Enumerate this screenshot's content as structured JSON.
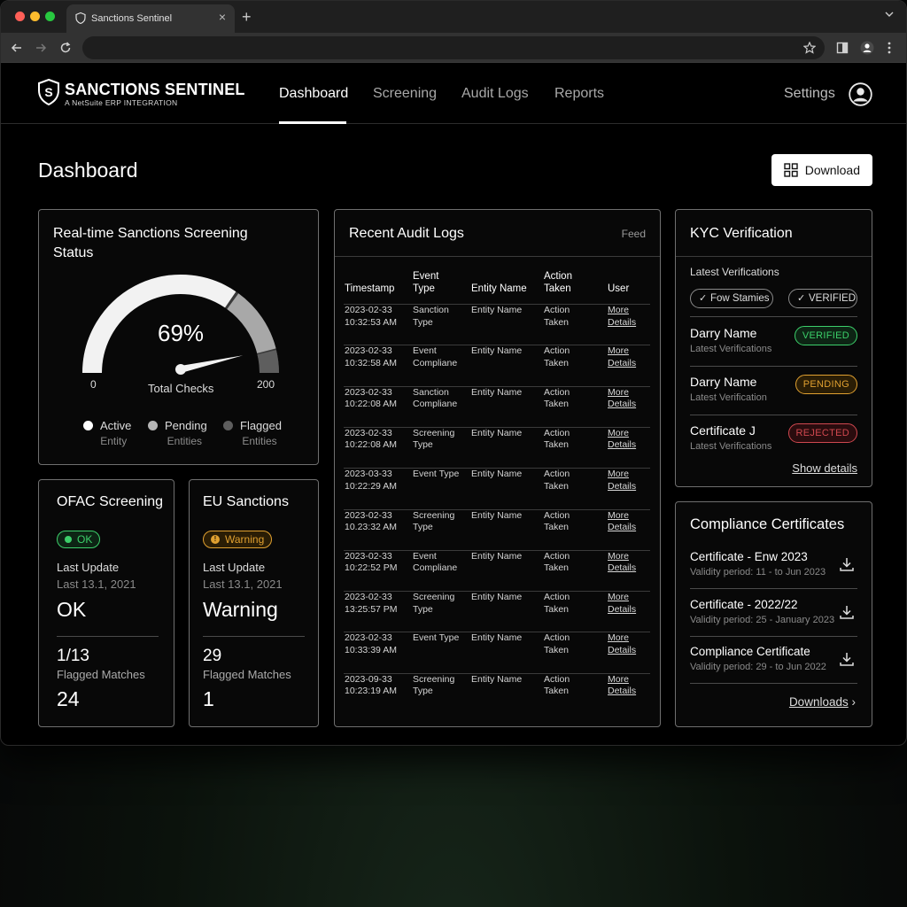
{
  "browser": {
    "tab_title": "Sanctions Sentinel",
    "tab_close": "×",
    "new_tab": "+"
  },
  "app": {
    "brand": "SANCTIONS SENTINEL",
    "brand_sub": "A NetSuite ERP INTEGRATION",
    "nav": [
      "Dashboard",
      "Screening",
      "Audit Logs",
      "Reports"
    ],
    "settings": "Settings"
  },
  "page": {
    "title": "Dashboard",
    "download_label": "Download"
  },
  "gauge_card": {
    "title": "Real-time Sanctions Screening Status",
    "percent": "69%",
    "percent_value": 69,
    "min": "0",
    "max": "200",
    "label": "Total Checks",
    "legend": [
      {
        "label": "Active",
        "sub": "Entity",
        "color": "#ffffff"
      },
      {
        "label": "Pending",
        "sub": "Entities",
        "color": "#b5b5b5"
      },
      {
        "label": "Flagged",
        "sub": "Entities",
        "color": "#5e5e5e"
      }
    ]
  },
  "ofac": {
    "title": "OFAC Screening",
    "badge": "OK",
    "last_update_label": "Last Update",
    "last_update_value": "Last 13.1, 2021",
    "status": "OK",
    "matches": "1/13",
    "matches_label": "Flagged Matches",
    "count": "24"
  },
  "eu": {
    "title": "EU Sanctions",
    "badge": "Warning",
    "last_update_label": "Last Update",
    "last_update_value": "Last 13.1, 2021",
    "status": "Warning",
    "matches": "29",
    "matches_label": "Flagged Matches",
    "count": "1"
  },
  "audit": {
    "title": "Recent Audit Logs",
    "feed": "Feed",
    "columns": [
      "Timestamp",
      "Event Type",
      "Entity Name",
      "Action Taken",
      "User"
    ],
    "rows": [
      {
        "ts": "2023-02-33 10:32:53 AM",
        "event": "Sanction Type",
        "entity": "Entity Name",
        "action": "Action Taken",
        "user": "More Details"
      },
      {
        "ts": "2023-02-33 10:32:58 AM",
        "event": "Event Compliane",
        "entity": "Entity Name",
        "action": "Action Taken",
        "user": "More Details"
      },
      {
        "ts": "2023-02-33 10:22:08 AM",
        "event": "Sanction Compliane",
        "entity": "Entity Name",
        "action": "Action Taken",
        "user": "More Details"
      },
      {
        "ts": "2023-02-33 10:22:08 AM",
        "event": "Screening Type",
        "entity": "Entity Name",
        "action": "Action Taken",
        "user": "More Details"
      },
      {
        "ts": "2023-03-33 10:22:29 AM",
        "event": "Event Type",
        "entity": "Entity Name",
        "action": "Action Taken",
        "user": "More Details"
      },
      {
        "ts": "2023-02-33 10.23:32 AM",
        "event": "Screening Type",
        "entity": "Entity Name",
        "action": "Action Taken",
        "user": "More Details"
      },
      {
        "ts": "2023-02-33 10:22:52 PM",
        "event": "Event Compliane",
        "entity": "Entity Name",
        "action": "Action Taken",
        "user": "More Details"
      },
      {
        "ts": "2023-02-33 13:25:57 PM",
        "event": "Screening Type",
        "entity": "Entity Name",
        "action": "Action Taken",
        "user": "More Details"
      },
      {
        "ts": "2023-02-33 10:33:39 AM",
        "event": "Event Type",
        "entity": "Entity Name",
        "action": "Action Taken",
        "user": "More Details"
      },
      {
        "ts": "2023-09-33 10:23:19 AM",
        "event": "Screening Type",
        "entity": "Entity Name",
        "action": "Action Taken",
        "user": "More Details"
      }
    ]
  },
  "kyc": {
    "title": "KYC Verification",
    "latest_label": "Latest Verifications",
    "chips": [
      "Fow Stamies",
      "VERIFIED"
    ],
    "items": [
      {
        "name": "Darry Name",
        "sub": "Latest Verifications",
        "status": "VERIFIED",
        "color": "#3ccf6a"
      },
      {
        "name": "Darry Name",
        "sub": "Latest Verification",
        "status": "PENDING",
        "color": "#e0a030"
      },
      {
        "name": "Certificate J",
        "sub": "Latest Verifications",
        "status": "REJECTED",
        "color": "#d0484f"
      }
    ],
    "show_details": "Show details"
  },
  "certs": {
    "title": "Compliance Certificates",
    "items": [
      {
        "name": "Certificate - Enw 2023",
        "sub": "Validity period: 11 - to Jun 2023"
      },
      {
        "name": "Certificate - 2022/22",
        "sub": "Validity period: 25 - January 2023"
      },
      {
        "name": "Compliance Certificate",
        "sub": "Validity period: 29 - to Jun 2022"
      }
    ],
    "downloads": "Downloads",
    "downloads_chevron": "›"
  },
  "colors": {
    "ok": "#3ccf6a",
    "warning": "#e0a030",
    "rejected": "#d0484f"
  }
}
